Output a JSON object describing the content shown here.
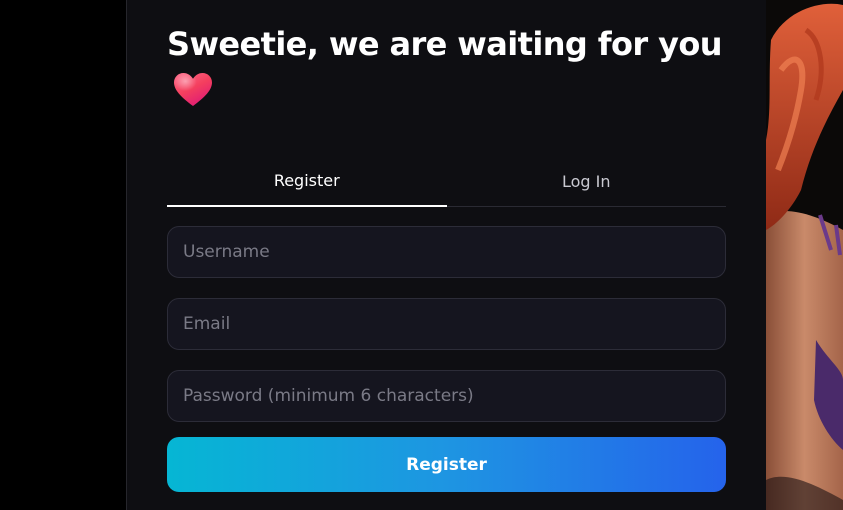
{
  "title": "Sweetie, we are waiting for you",
  "title_icon": "heart-icon",
  "tabs": [
    {
      "label": "Register",
      "active": true
    },
    {
      "label": "Log In",
      "active": false
    }
  ],
  "form": {
    "username_placeholder": "Username",
    "email_placeholder": "Email",
    "password_placeholder": "Password (minimum 6 characters)",
    "submit_label": "Register"
  },
  "colors": {
    "background": "#0e0e12",
    "field_background": "#15151f",
    "button_gradient_start": "#06b6d4",
    "button_gradient_end": "#2563eb",
    "heart": "#f43f5e"
  }
}
